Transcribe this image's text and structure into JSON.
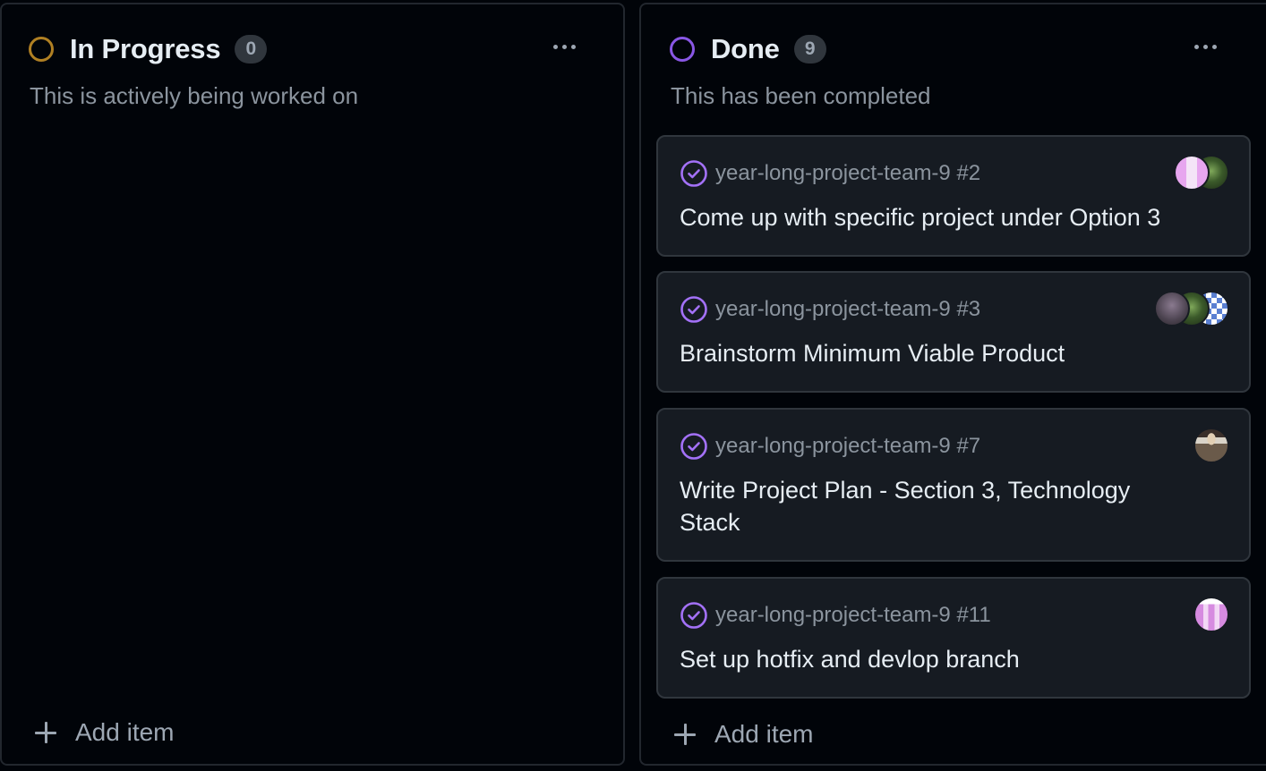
{
  "columns": [
    {
      "title": "In Progress",
      "count": "0",
      "status_color": "#b08023",
      "description": "This is actively being worked on",
      "add_item_label": "Add item",
      "cards": []
    },
    {
      "title": "Done",
      "count": "9",
      "status_color": "#8957e5",
      "description": "This has been completed",
      "add_item_label": "Add item",
      "cards": [
        {
          "repo": "year-long-project-team-9 #2",
          "title": "Come up with specific project under Option 3",
          "avatars": [
            "pink",
            "green"
          ]
        },
        {
          "repo": "year-long-project-team-9 #3",
          "title": "Brainstorm Minimum Viable Product",
          "avatars": [
            "grey",
            "green",
            "blue"
          ]
        },
        {
          "repo": "year-long-project-team-9 #7",
          "title": "Write Project Plan - Section 3, Technology Stack",
          "avatars": [
            "person"
          ]
        },
        {
          "repo": "year-long-project-team-9 #11",
          "title": "Set up hotfix and devlop branch",
          "avatars": [
            "pink2"
          ]
        }
      ]
    }
  ],
  "icons": {
    "status": "circle-icon",
    "closed_issue": "check-circle-icon",
    "menu": "kebab-menu-icon",
    "add": "plus-icon"
  }
}
